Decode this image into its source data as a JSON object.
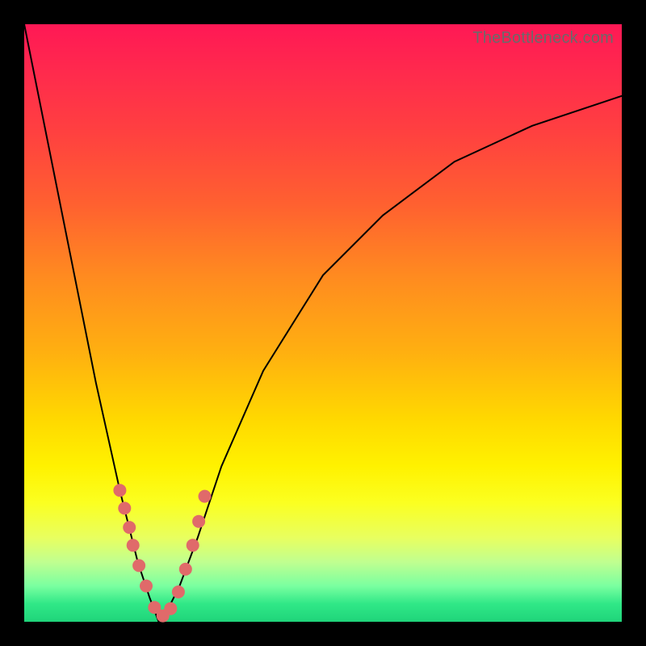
{
  "watermark": "TheBottleneck.com",
  "colors": {
    "frame": "#000000",
    "curve": "#000000",
    "marker": "#e06a6a",
    "gradient_top": "#ff1855",
    "gradient_bottom": "#1fd47a"
  },
  "chart_data": {
    "type": "line",
    "title": "",
    "xlabel": "",
    "ylabel": "",
    "xlim": [
      0,
      1
    ],
    "ylim": [
      0,
      1
    ],
    "note": "V-shaped bottleneck curve; minimum (green) near x≈0.23 on a normalized 0–1 axis. No numeric axis ticks are shown in the image — x and y are normalized.",
    "series": [
      {
        "name": "bottleneck-curve",
        "x": [
          0.0,
          0.04,
          0.08,
          0.12,
          0.16,
          0.19,
          0.21,
          0.225,
          0.24,
          0.26,
          0.29,
          0.33,
          0.4,
          0.5,
          0.6,
          0.72,
          0.85,
          1.0
        ],
        "y": [
          1.0,
          0.8,
          0.6,
          0.4,
          0.22,
          0.1,
          0.04,
          0.0,
          0.02,
          0.06,
          0.14,
          0.26,
          0.42,
          0.58,
          0.68,
          0.77,
          0.83,
          0.88
        ]
      }
    ],
    "markers": {
      "name": "highlight-points",
      "x": [
        0.16,
        0.168,
        0.176,
        0.182,
        0.192,
        0.204,
        0.218,
        0.232,
        0.245,
        0.258,
        0.27,
        0.282,
        0.292,
        0.302
      ],
      "y": [
        0.22,
        0.19,
        0.158,
        0.128,
        0.094,
        0.06,
        0.024,
        0.01,
        0.022,
        0.05,
        0.088,
        0.128,
        0.168,
        0.21
      ]
    }
  }
}
